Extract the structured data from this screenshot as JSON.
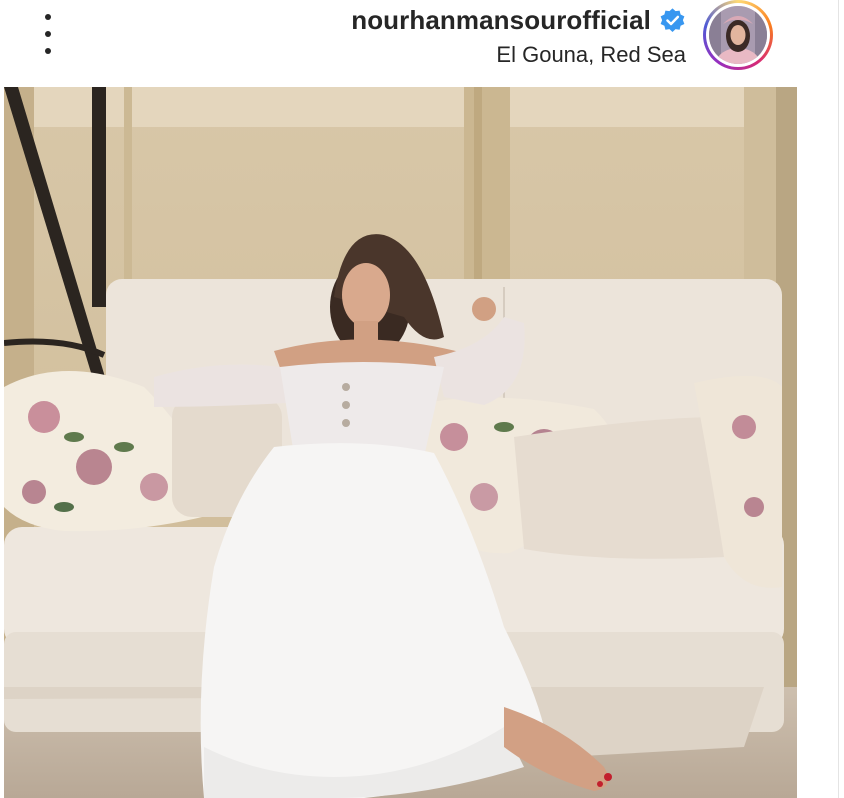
{
  "post": {
    "header": {
      "username": "nourhanmansourofficial",
      "location": "El Gouna, Red Sea",
      "verified": true,
      "more_icon": "more-vertical-icon",
      "verified_icon": "verified-badge-icon"
    },
    "avatar": {
      "ring_colors": [
        "#feda75",
        "#fa7e1e",
        "#d62976",
        "#962fbf",
        "#4f5bd5"
      ]
    },
    "image": {
      "subject": "woman in white dress reclining on a cream outdoor swing sofa with floral cushions"
    }
  },
  "colors": {
    "text": "#262626",
    "verified_blue": "#3897f0",
    "background": "#ffffff"
  }
}
